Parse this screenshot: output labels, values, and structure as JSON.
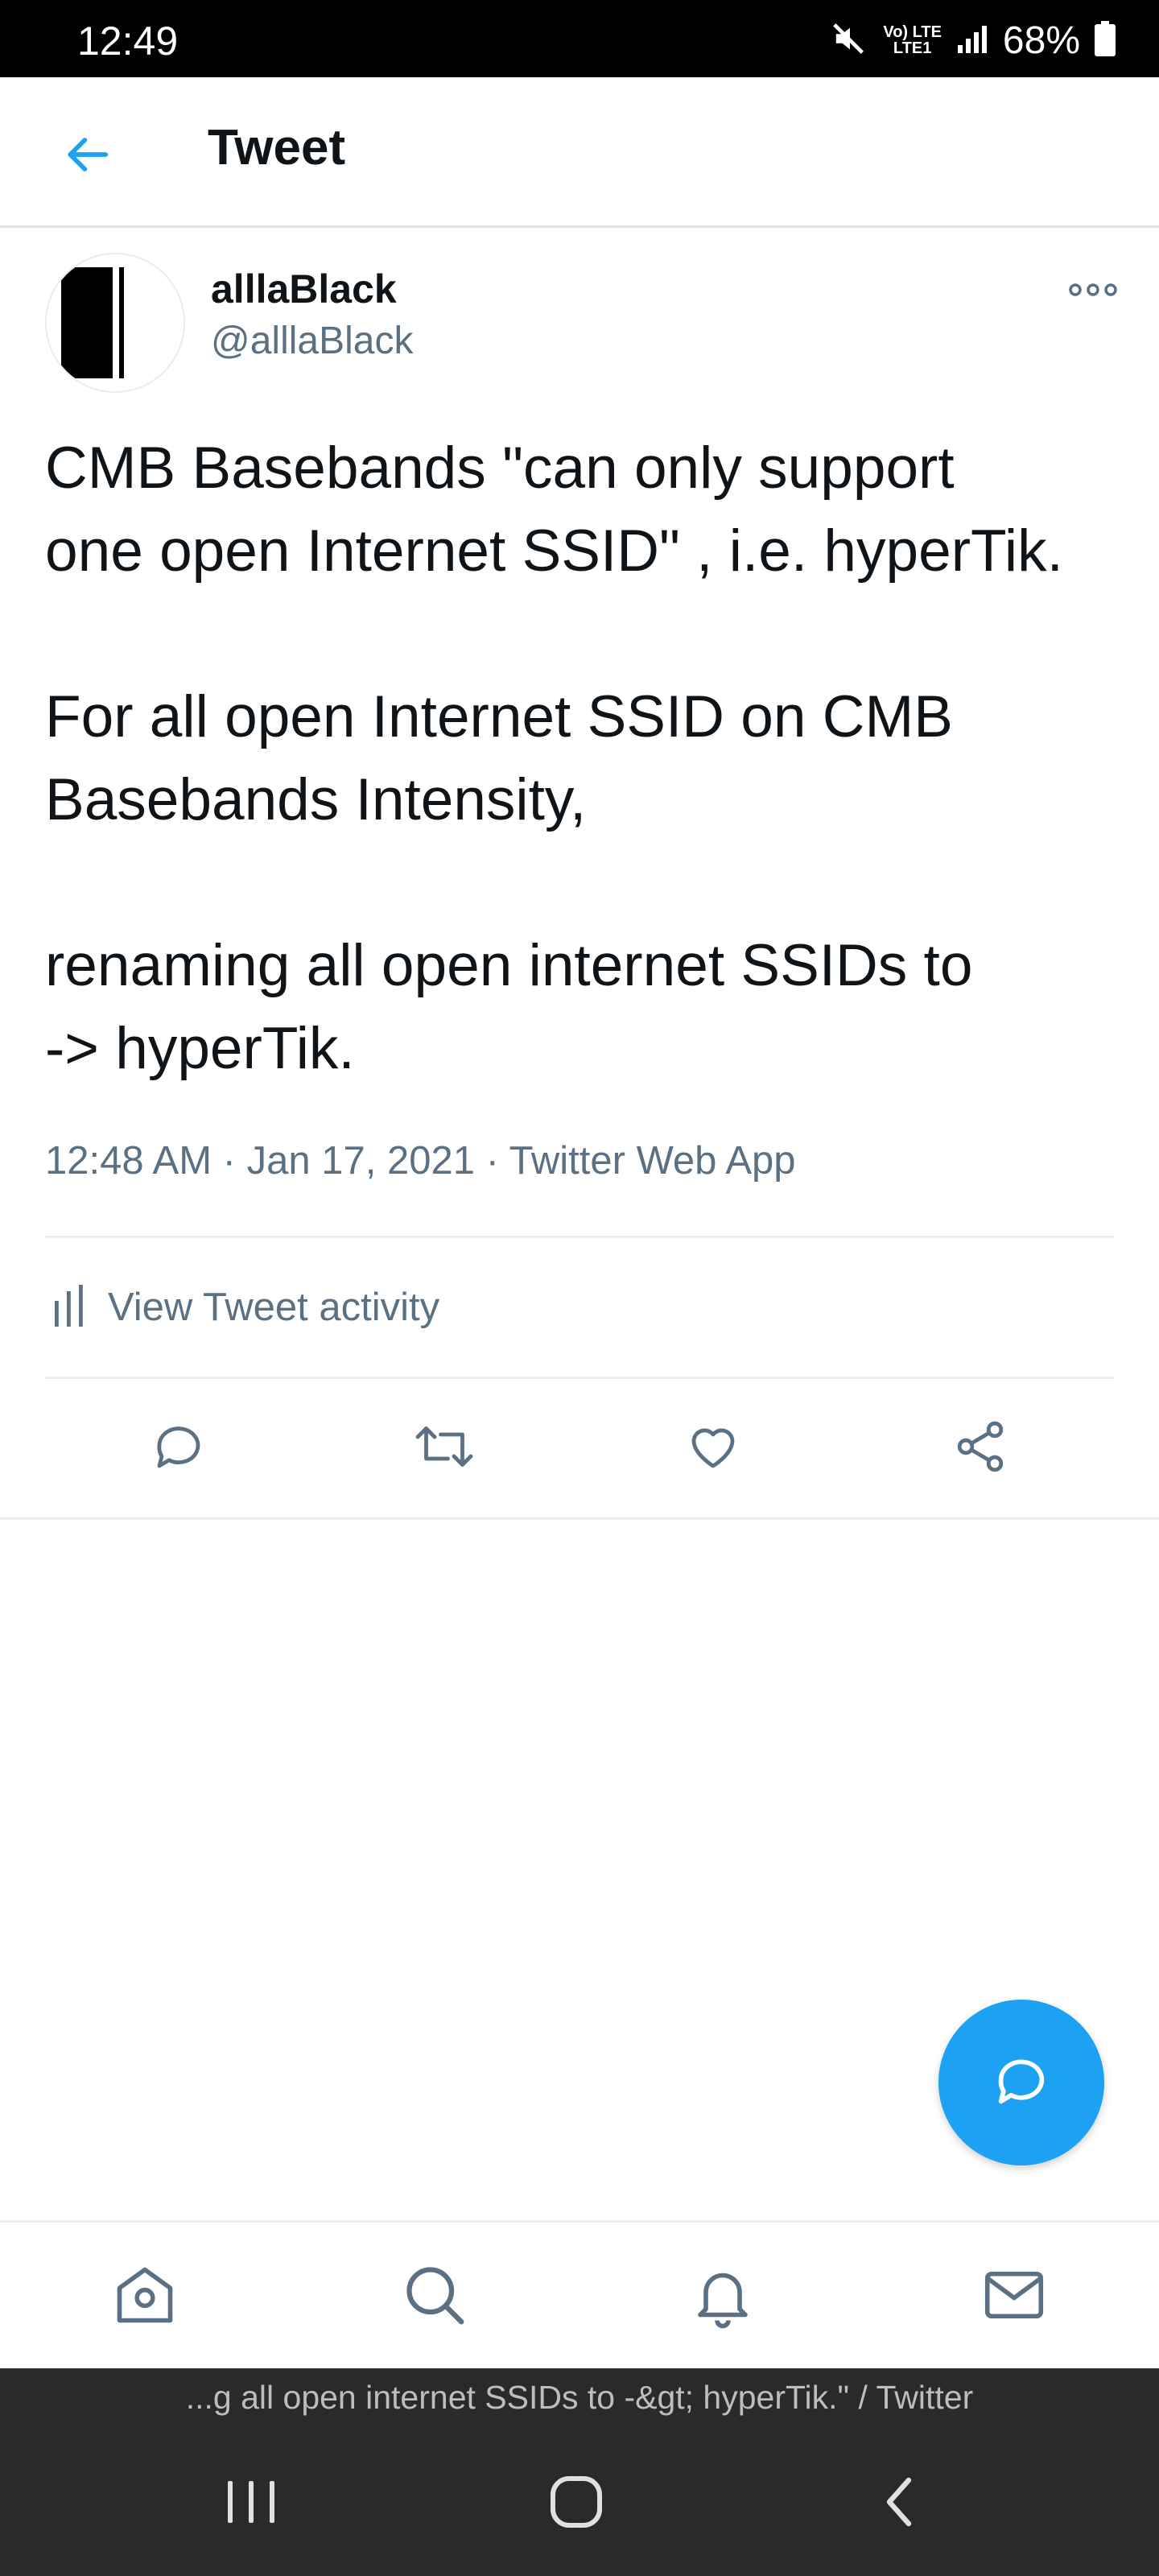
{
  "status_bar": {
    "time": "12:49",
    "network_label": "Vo) LTE",
    "network_sub": "LTE1",
    "battery": "68%",
    "icons": [
      "mute-icon",
      "lte-icon",
      "signal-icon",
      "battery-icon"
    ]
  },
  "header": {
    "title": "Tweet",
    "back_icon": "arrow-left-icon"
  },
  "tweet": {
    "author_name": "alllaBlack",
    "author_handle": "@alllaBlack",
    "paragraph_1_line_1": "CMB Basebands \"can only support",
    "paragraph_1_line_2": "one open Internet SSID\" , i.e. hyperTik.",
    "paragraph_2_line_1": "For all open Internet SSID on CMB",
    "paragraph_2_line_2": "Basebands Intensity,",
    "paragraph_3_line_1": "renaming all open internet SSIDs to",
    "paragraph_3_line_2": "-> hyperTik.",
    "time": "12:48 AM",
    "date": "Jan 17, 2021",
    "source": "Twitter Web App",
    "separator": "·"
  },
  "activity": {
    "label": "View Tweet activity"
  },
  "actions": [
    "reply-icon",
    "retweet-icon",
    "like-icon",
    "share-icon"
  ],
  "bottom_tabs": [
    "home-icon",
    "search-icon",
    "notifications-icon",
    "messages-icon"
  ],
  "system_nav": {
    "caption": "...g all open internet SSIDs to -&gt; hyperTik.\" / Twitter",
    "buttons": [
      "recents-icon",
      "home-circle-icon",
      "back-chevron-icon"
    ]
  },
  "colors": {
    "accent": "#1da1f2",
    "secondary_text": "#5b7083",
    "primary_text": "#0f1419",
    "divider": "#e6ecf0"
  }
}
